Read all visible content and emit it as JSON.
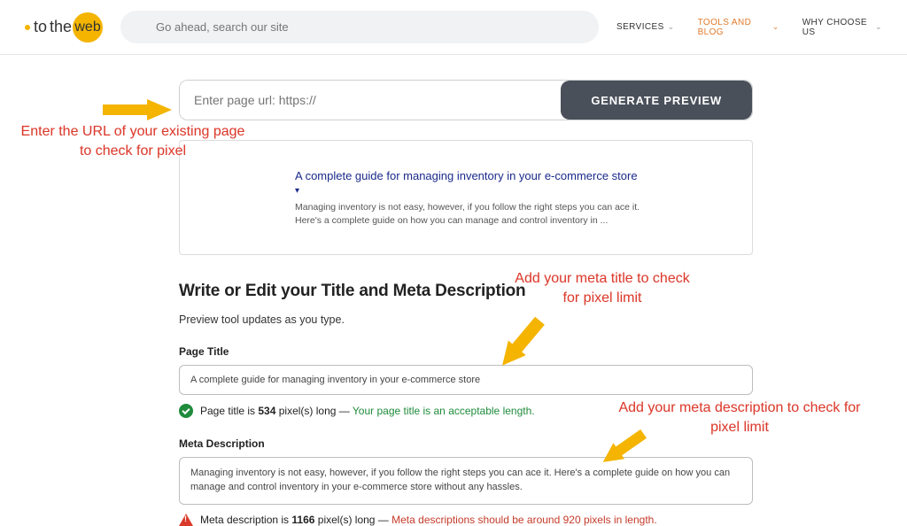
{
  "header": {
    "logo_pre": "to",
    "logo_mid": "the",
    "logo_post": "web",
    "search_placeholder": "Go ahead, search our site",
    "nav": {
      "services": "SERVICES",
      "tools_blog": "TOOLS AND BLOG",
      "why": "WHY CHOOSE US"
    }
  },
  "tool": {
    "url_placeholder": "Enter page url: https://",
    "generate_btn": "GENERATE PREVIEW",
    "preview": {
      "title": "A complete guide for managing inventory in your e-commerce store",
      "desc": "Managing inventory is not easy, however, if you follow the right steps you can ace it. Here's a complete guide on how you can manage and control inventory in ..."
    },
    "section_heading": "Write or Edit your Title and Meta Description",
    "section_sub": "Preview tool updates as you type.",
    "title_label": "Page Title",
    "title_value": "A complete guide for managing inventory in your e-commerce store",
    "title_status_prefix": "Page title is ",
    "title_status_px": "534",
    "title_status_suffix": " pixel(s) long — ",
    "title_status_msg": "Your page title is an acceptable length.",
    "desc_label": "Meta Description",
    "desc_value": "Managing inventory is not easy, however, if you follow the right steps you can ace it. Here's a complete guide on how you can manage and control inventory in your e-commerce store without any hassles.",
    "desc_status_prefix": "Meta description is ",
    "desc_status_px": "1166",
    "desc_status_suffix": " pixel(s) long — ",
    "desc_status_msg": "Meta descriptions should be around 920 pixels in length."
  },
  "annotations": {
    "a1": "Enter the URL of your existing page to check for pixel",
    "a2": "Add your meta title to check for pixel limit",
    "a3": "Add your meta description to check for pixel limit"
  }
}
